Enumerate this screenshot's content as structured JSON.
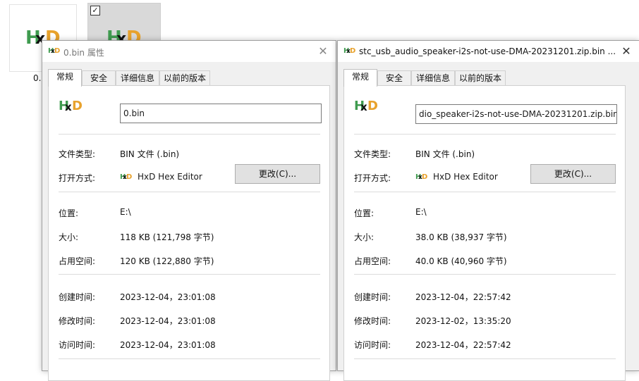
{
  "desktop": {
    "file1_caption": "0."
  },
  "dialog1": {
    "title": "0.bin 属性",
    "tabs": [
      "常规",
      "安全",
      "详细信息",
      "以前的版本"
    ],
    "filename": "0.bin",
    "type_label": "文件类型:",
    "type_value": "BIN 文件 (.bin)",
    "open_label": "打开方式:",
    "open_value": "HxD Hex Editor",
    "change_button": "更改(C)...",
    "location_label": "位置:",
    "location_value": "E:\\",
    "size_label": "大小:",
    "size_value": "118 KB (121,798 字节)",
    "disk_label": "占用空间:",
    "disk_value": "120 KB (122,880 字节)",
    "created_label": "创建时间:",
    "created_value": "2023-12-04，23:01:08",
    "modified_label": "修改时间:",
    "modified_value": "2023-12-04，23:01:08",
    "accessed_label": "访问时间:",
    "accessed_value": "2023-12-04，23:01:08",
    "close_glyph": "✕"
  },
  "dialog2": {
    "title": "stc_usb_audio_speaker-i2s-not-use-DMA-20231201.zip.bin ...",
    "tabs": [
      "常规",
      "安全",
      "详细信息",
      "以前的版本"
    ],
    "filename": "dio_speaker-i2s-not-use-DMA-20231201.zip.bin",
    "type_label": "文件类型:",
    "type_value": "BIN 文件 (.bin)",
    "open_label": "打开方式:",
    "open_value": "HxD Hex Editor",
    "change_button": "更改(C)...",
    "location_label": "位置:",
    "location_value": "E:\\",
    "size_label": "大小:",
    "size_value": "38.0 KB (38,937 字节)",
    "disk_label": "占用空间:",
    "disk_value": "40.0 KB (40,960 字节)",
    "created_label": "创建时间:",
    "created_value": "2023-12-04，22:57:42",
    "modified_label": "修改时间:",
    "modified_value": "2023-12-02，13:35:20",
    "accessed_label": "访问时间:",
    "accessed_value": "2023-12-04，22:57:42",
    "close_glyph": "✕"
  },
  "icons": {
    "app_logo": "hxd-logo-icon",
    "checkbox": "checkbox-checked-icon",
    "close": "close-icon"
  },
  "colors": {
    "logo_green": "#3f9b4f",
    "logo_orange": "#e8a22c",
    "dialog_bg": "#f0f0f0",
    "button_bg": "#e1e1e1"
  }
}
